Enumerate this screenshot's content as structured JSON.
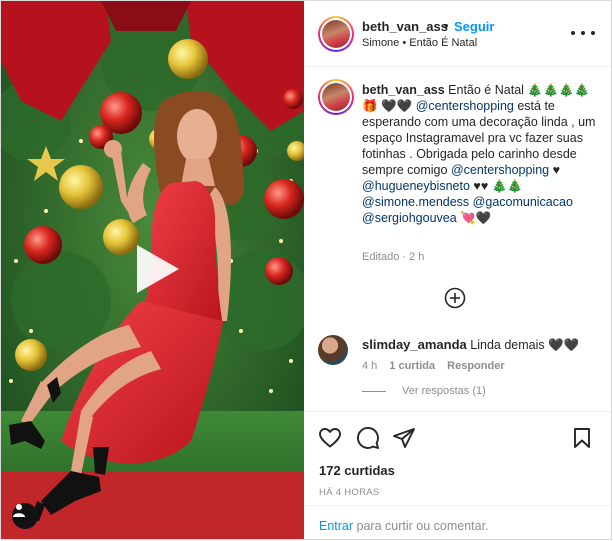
{
  "post": {
    "username": "beth_van_ass",
    "dot": "•",
    "follow_label": "Seguir",
    "location": "Simone • Então É Natal"
  },
  "caption": {
    "username": "beth_van_ass",
    "text_1": "Então é Natal 🎄🎄🎄🎄🎁",
    "text_2": "🖤🖤",
    "mention_1": "@centershopping",
    "text_3": "está te esperando com uma decoração linda , um espaço Instagramavel pra vc fazer suas fotinhas . Obrigada pelo carinho desde sempre comigo",
    "mention_2": "@centershopping",
    "text_4": "♥",
    "mention_3": "@hugueneybisneto",
    "text_5": "♥♥ 🎄🎄",
    "mention_4": "@simone.mendess",
    "mention_5": "@gacomunicacao",
    "mention_6": "@sergiohgouvea",
    "text_6": "💘🖤",
    "meta": "Editado · 2 h"
  },
  "comment": {
    "username": "slimday_amanda",
    "text": "Linda demais 🖤🖤",
    "time": "4 h",
    "likes": "1 curtida",
    "reply": "Responder",
    "view_replies": "Ver respostas (1)"
  },
  "footer": {
    "likes": "172 curtidas",
    "time": "HÁ 4 HORAS",
    "login_link": "Entrar",
    "login_text": "para curtir ou comentar."
  },
  "icons": {
    "more": "more-options-icon",
    "load_more": "plus-circle-icon",
    "like": "heart-icon",
    "comment": "comment-icon",
    "share": "paper-plane-icon",
    "save": "bookmark-icon",
    "play": "play-icon",
    "tag": "user-tag-icon"
  },
  "colors": {
    "accent_blue": "#0095f6",
    "mention_blue": "#00376b",
    "muted": "#8e8e8e",
    "dress_red": "#e0262e"
  }
}
